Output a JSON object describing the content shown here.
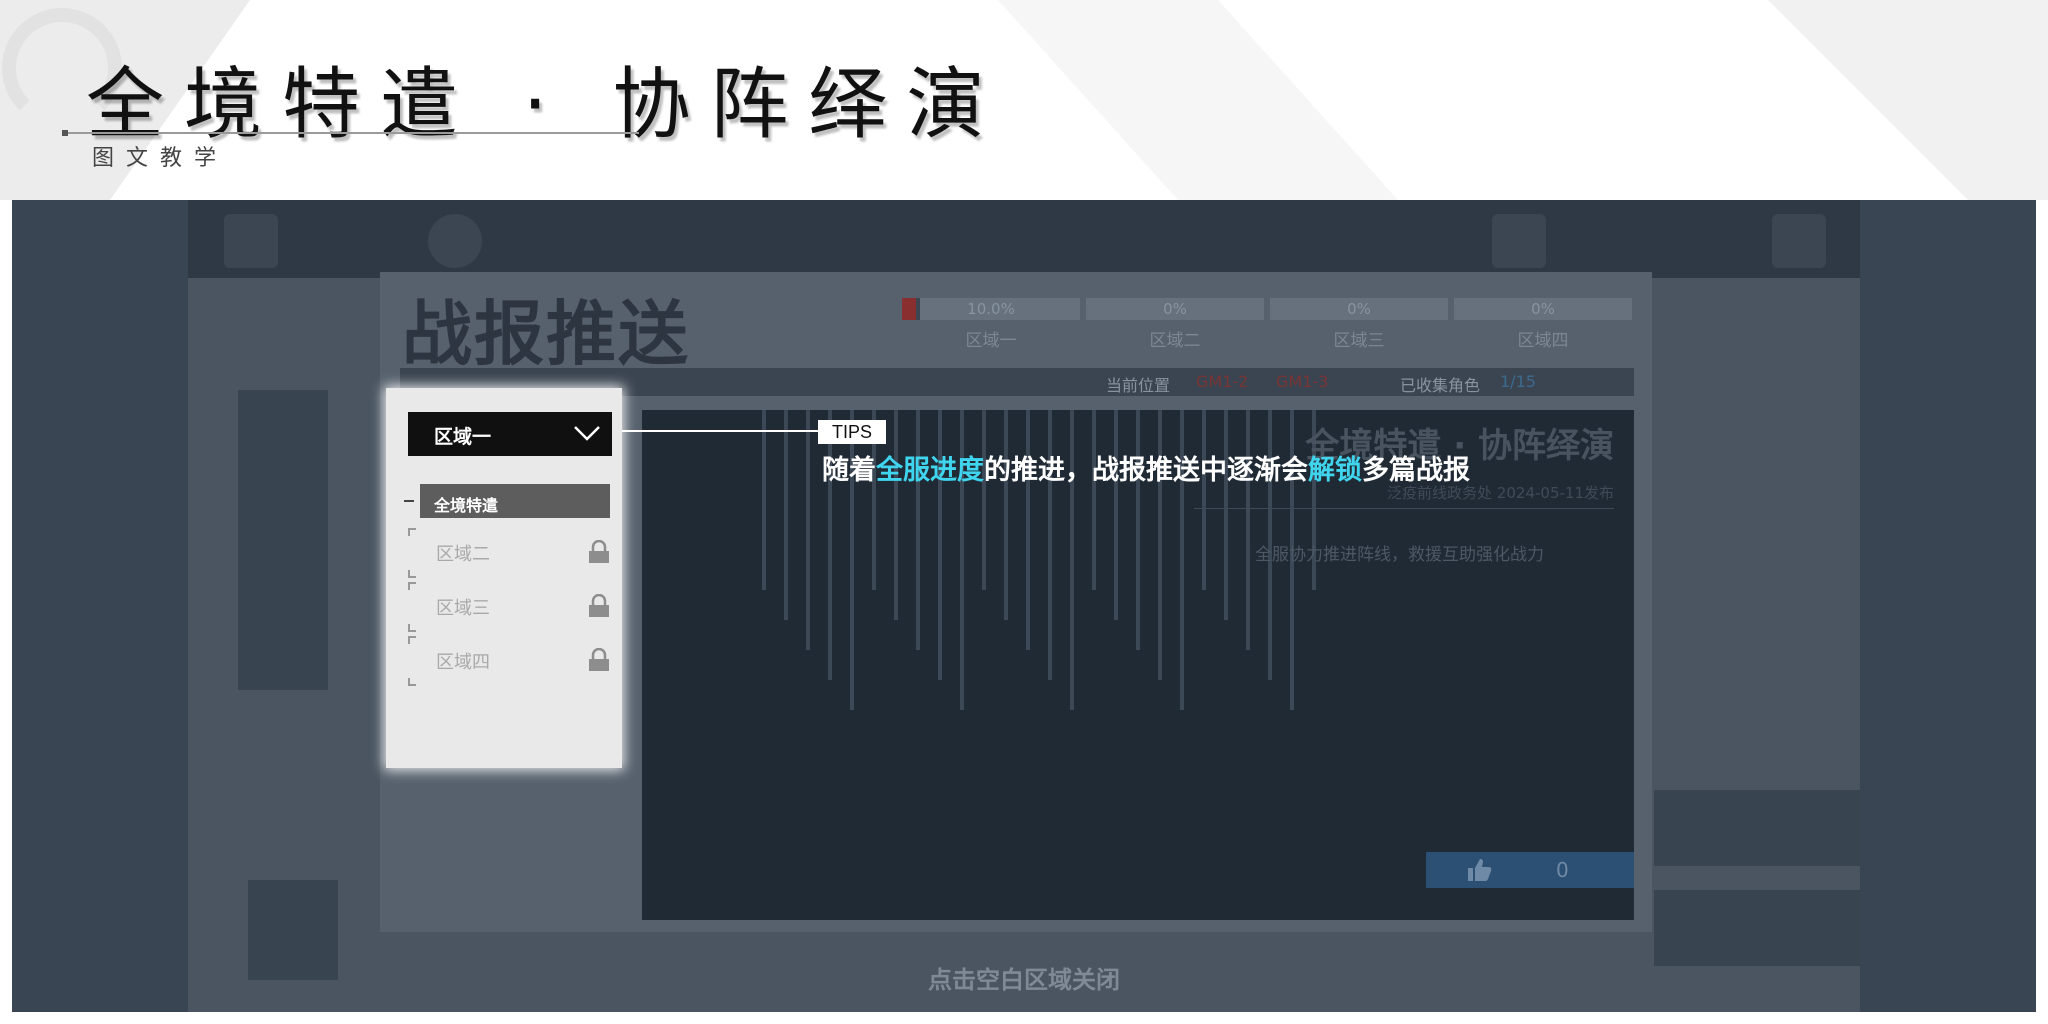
{
  "header": {
    "title": "全境特遣 · 协阵绎演",
    "subtitle": "图文教学"
  },
  "modal": {
    "title": "战报推送",
    "zones": [
      {
        "label": "区域一",
        "progress_text": "10.0%",
        "progress": 0.1
      },
      {
        "label": "区域二",
        "progress_text": "0%",
        "progress": 0
      },
      {
        "label": "区域三",
        "progress_text": "0%",
        "progress": 0
      },
      {
        "label": "区域四",
        "progress_text": "0%",
        "progress": 0
      }
    ],
    "status": {
      "position_label": "当前位置",
      "position_a": "GM1-2",
      "position_b": "GM1-3",
      "collected_label": "已收集角色",
      "collected_value": "1/15"
    },
    "report": {
      "title": "全境特遣 · 协阵绎演",
      "meta": "泛疫前线政务处  2024-05-11发布",
      "description": "全服协力推进阵线，救援互助强化战力",
      "likes": "0"
    },
    "close_hint": "点击空白区域关闭"
  },
  "dropdown": {
    "selected": "区域一",
    "active_item": "全境特遣",
    "items": [
      {
        "label": "区域二",
        "locked": true
      },
      {
        "label": "区域三",
        "locked": true
      },
      {
        "label": "区域四",
        "locked": true
      }
    ]
  },
  "tips": {
    "tag": "TIPS",
    "text_parts": [
      {
        "t": "随着",
        "hl": false
      },
      {
        "t": "全服进度",
        "hl": true
      },
      {
        "t": "的推进，战报推送中逐渐会",
        "hl": false
      },
      {
        "t": "解锁",
        "hl": true
      },
      {
        "t": "多篇战报",
        "hl": false
      }
    ]
  },
  "colors": {
    "highlight": "#40d5ee",
    "frame_bg": "#3a4553",
    "modal_bg": "#56616d",
    "like_bg": "#2c5073"
  }
}
